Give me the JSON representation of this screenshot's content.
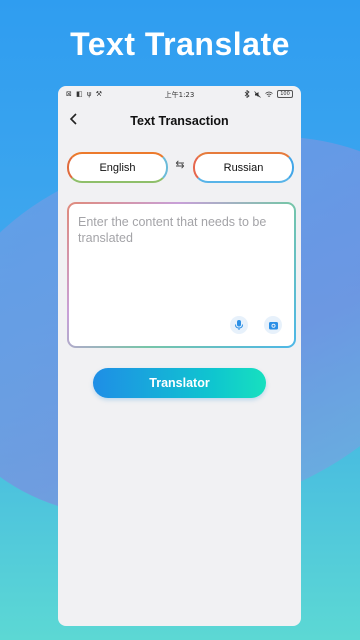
{
  "promo": {
    "headline": "Text Translate"
  },
  "status_bar": {
    "left_icons": "⊠ ◧ ψ ⚒",
    "time": "上午1:23",
    "battery": "100"
  },
  "navbar": {
    "title": "Text Transaction"
  },
  "languages": {
    "source": "English",
    "target": "Russian",
    "swap_icon": "⇆"
  },
  "input": {
    "placeholder": "Enter the content that needs to be translated",
    "value": ""
  },
  "actions": {
    "translate_label": "Translator"
  },
  "colors": {
    "accent_start": "#1f8ee6",
    "accent_end": "#17e0bf",
    "background_top": "#2f9df0",
    "background_bottom": "#5cd8d4"
  }
}
